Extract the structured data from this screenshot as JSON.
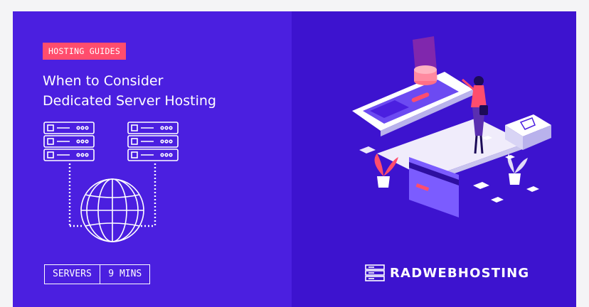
{
  "hero": {
    "tag": "HOSTING GUIDES",
    "title_line1": "When to Consider",
    "title_line2": "Dedicated Server Hosting",
    "category": "SERVERS",
    "read_time": "9 MINS"
  },
  "brand": {
    "name": "RadWebHosting",
    "logo_text": "RADWEBHOSTING"
  },
  "icons": [
    "server-rack-icon",
    "globe-icon",
    "shopping-cart-icon",
    "plant-icon",
    "credit-card-icon",
    "user-illustration",
    "logo-icon"
  ],
  "colors": {
    "left_panel": "#4b1fe0",
    "right_panel": "#3d13cf",
    "tag_bg": "#ff4d6d",
    "text": "#ffffff"
  }
}
